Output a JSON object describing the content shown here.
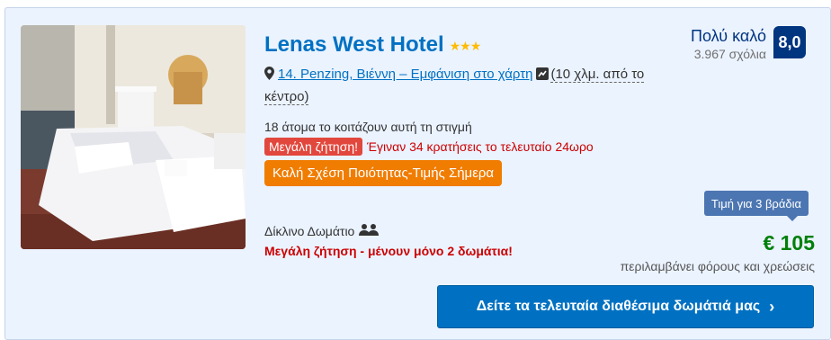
{
  "hotel": {
    "name": "Lenas West Hotel",
    "stars": "★★★",
    "star_rating": 3,
    "location_link": "14. Penzing, Βιέννη – Εμφάνιση στο χάρτη",
    "distance_open": "(10 χλμ. από το",
    "distance_close": "κέντρο)",
    "viewers": "18 άτομα το κοιτάζουν αυτή τη στιγμή",
    "high_demand_badge": "Μεγάλη ζήτηση!",
    "bookings_text": "Έγιναν 34 κρατήσεις το τελευταίο 24ωρο",
    "deal_badge": "Καλή Σχέση Ποιότητας-Τιμής Σήμερα",
    "room_type": "Δίκλινο Δωμάτιο",
    "rooms_left": "Μεγάλη ζήτηση - μένουν μόνο 2 δωμάτια!"
  },
  "review": {
    "word": "Πολύ καλό",
    "count": "3.967 σχόλια",
    "score": "8,0"
  },
  "pricing": {
    "nights_label": "Τιμή για 3 βράδια",
    "price": "€ 105",
    "taxes_note": "περιλαμβάνει φόρους και χρεώσεις"
  },
  "cta": {
    "label": "Δείτε τα τελευταία διαθέσιμα δωμάτιά μας",
    "chevron": "›"
  },
  "icons": {
    "location": "map-pin-icon",
    "distance": "distance-icon",
    "occupancy": "two-persons-icon",
    "image": "hotel-room-photo"
  },
  "colors": {
    "link_blue": "#0071c2",
    "navy": "#003580",
    "star_yellow": "#febb02",
    "alert_red": "#cc0000",
    "badge_red": "#e2473d",
    "deal_orange": "#f07c00",
    "price_green": "#008009",
    "card_bg": "#ebf3ff"
  }
}
